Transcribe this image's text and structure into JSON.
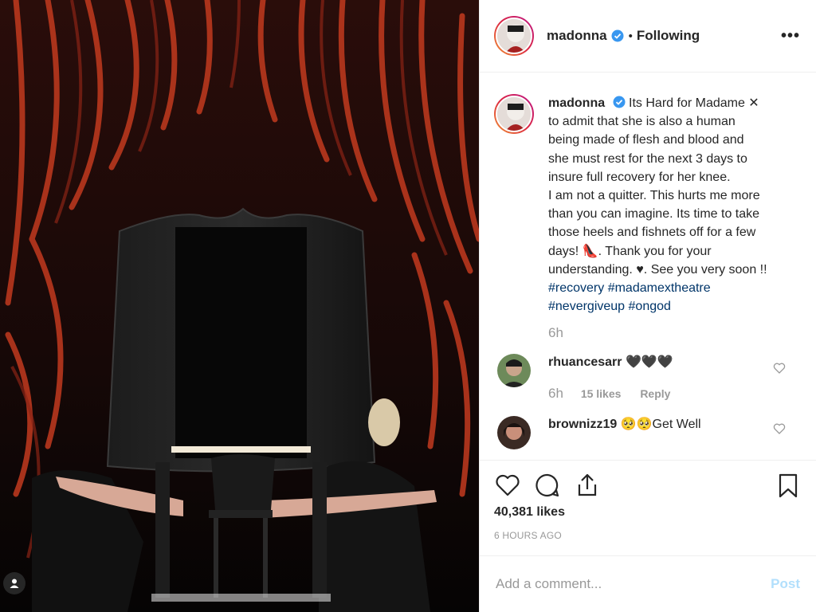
{
  "header": {
    "username": "madonna",
    "follow_sep": "•",
    "follow_status": "Following",
    "more": "•••"
  },
  "caption": {
    "username": "madonna",
    "lines": [
      "Its Hard for Madame ✕",
      "to admit that she is also a human",
      "being made of flesh and blood and",
      "she must rest for the next 3 days to",
      "insure full recovery for her knee.",
      "I am not a quitter. This hurts me more",
      "than you can imagine. Its time to take",
      "those heels and fishnets off for a few",
      "days! 👠. Thank you for your",
      "understanding. ♥. See you very soon !!"
    ],
    "hashtags_line1": "#recovery #madamextheatre",
    "hashtags_line2": "#nevergiveup #ongod",
    "time": "6h"
  },
  "comments": [
    {
      "username": "rhuancesarr",
      "text": "🖤🖤🖤",
      "time": "6h",
      "likes": "15 likes",
      "reply": "Reply"
    },
    {
      "username": "brownizz19",
      "text": "🥺🥺Get Well"
    }
  ],
  "actions": {
    "likes": "40,381 likes",
    "time_ago": "6 HOURS AGO"
  },
  "add_comment": {
    "placeholder": "Add a comment...",
    "post_label": "Post"
  },
  "colors": {
    "link": "#003569",
    "muted": "#999999",
    "post_disabled": "#b2dffc",
    "verified": "#3897f0"
  }
}
